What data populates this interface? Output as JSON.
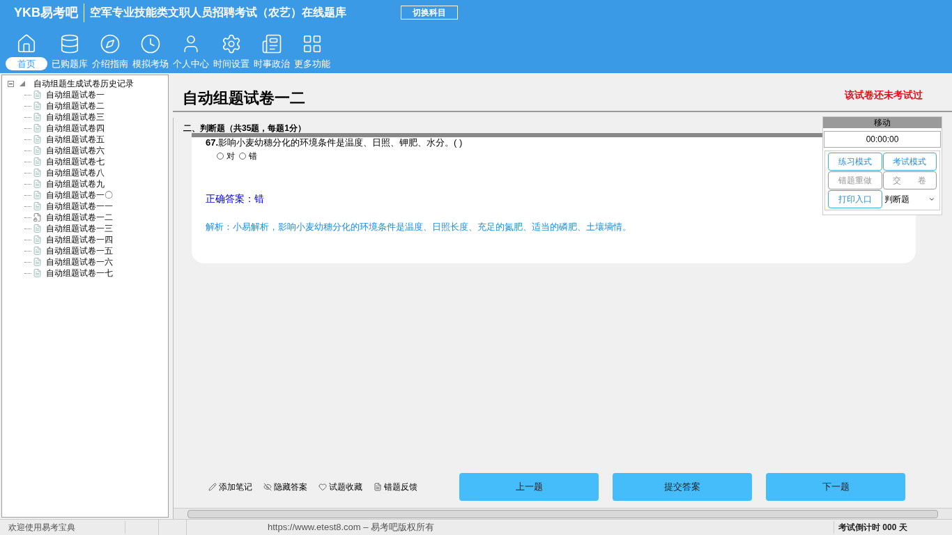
{
  "header": {
    "logo": "YKB易考吧",
    "title": "空军专业技能类文职人员招聘考试（农艺）在线题库",
    "switch_button": "切换科目"
  },
  "nav": [
    {
      "label": "首页",
      "selected": true
    },
    {
      "label": "已购题库",
      "selected": false
    },
    {
      "label": "介绍指南",
      "selected": false
    },
    {
      "label": "模拟考场",
      "selected": false
    },
    {
      "label": "个人中心",
      "selected": false
    },
    {
      "label": "时间设置",
      "selected": false
    },
    {
      "label": "时事政治",
      "selected": false
    },
    {
      "label": "更多功能",
      "selected": false
    }
  ],
  "tree": {
    "label": "自动组题生成试卷历史记录",
    "expanded": true,
    "children": [
      {
        "label": "自动组题试卷一",
        "current": false
      },
      {
        "label": "自动组题试卷二",
        "current": false
      },
      {
        "label": "自动组题试卷三",
        "current": false
      },
      {
        "label": "自动组题试卷四",
        "current": false
      },
      {
        "label": "自动组题试卷五",
        "current": false
      },
      {
        "label": "自动组题试卷六",
        "current": false
      },
      {
        "label": "自动组题试卷七",
        "current": false
      },
      {
        "label": "自动组题试卷八",
        "current": false
      },
      {
        "label": "自动组题试卷九",
        "current": false
      },
      {
        "label": "自动组题试卷一〇",
        "current": false
      },
      {
        "label": "自动组题试卷一一",
        "current": false
      },
      {
        "label": "自动组题试卷一二",
        "current": true
      },
      {
        "label": "自动组题试卷一三",
        "current": false
      },
      {
        "label": "自动组题试卷一四",
        "current": false
      },
      {
        "label": "自动组题试卷一五",
        "current": false
      },
      {
        "label": "自动组题试卷一六",
        "current": false
      },
      {
        "label": "自动组题试卷一七",
        "current": false
      }
    ]
  },
  "paper": {
    "title": "自动组题试卷一二",
    "status": "该试卷还未考试过",
    "section": "二、判断题（共35题，每题1分）"
  },
  "question": {
    "number": "67.",
    "text": "影响小麦幼穗分化的环境条件是温度、日照、钾肥、水分。( )",
    "options": [
      {
        "label": "对",
        "selected": false
      },
      {
        "label": "错",
        "selected": false
      }
    ],
    "answer": "正确答案：错",
    "analysis": "解析：小易解析，影响小麦幼穗分化的环境条件是温度、日照长度、充足的氮肥、适当的磷肥、土壤墒情。"
  },
  "control_panel": {
    "header": "移动",
    "timer": "00:00:00",
    "buttons": [
      {
        "label": "练习模式",
        "disabled": false
      },
      {
        "label": "考试模式",
        "disabled": false
      },
      {
        "label": "错题重做",
        "disabled": true
      },
      {
        "label": "交　　卷",
        "disabled": true
      },
      {
        "label": "打印入口",
        "disabled": false
      }
    ],
    "type_select": "判断题"
  },
  "tools": [
    "添加笔记",
    "隐藏答案",
    "试题收藏",
    "错题反馈"
  ],
  "nav_buttons": [
    "上一题",
    "提交答案",
    "下一题"
  ],
  "status_bar": {
    "welcome": "欢迎使用易考宝典",
    "copyright": "https://www.etest8.com – 易考吧版权所有",
    "countdown": "考试倒计时 000 天"
  }
}
